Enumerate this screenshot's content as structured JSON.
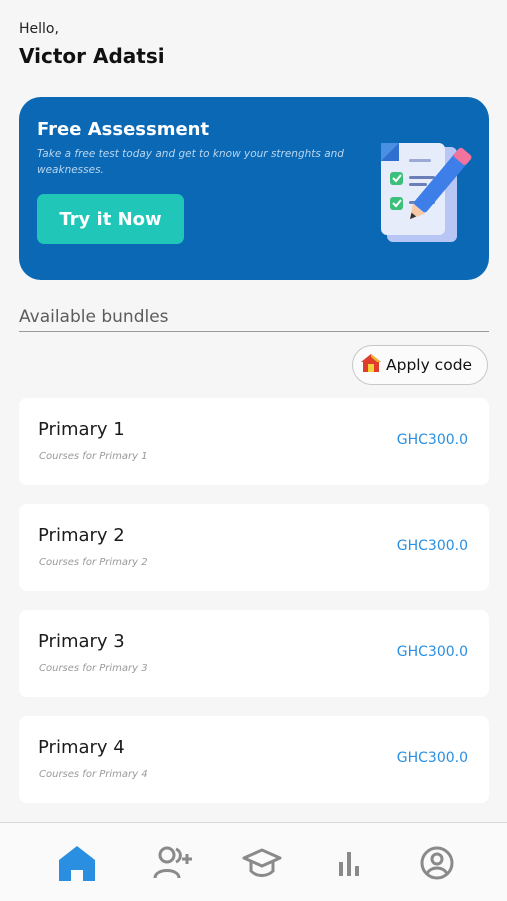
{
  "header": {
    "greeting": "Hello,",
    "user_name": "Victor Adatsi"
  },
  "promo": {
    "title": "Free Assessment",
    "subtitle": "Take a free test today and get to know your strenghts and weaknesses.",
    "button_label": "Try it Now",
    "illustration": "checklist-pencil-icon",
    "bg_color": "#0b68b5",
    "button_color": "#20c7b8"
  },
  "bundles_section": {
    "title": "Available bundles",
    "apply_code_label": "Apply code",
    "apply_code_icon": "house-tag-icon"
  },
  "bundles": [
    {
      "name": "Primary 1",
      "description": "Courses for Primary 1",
      "price": "GHC300.0"
    },
    {
      "name": "Primary 2",
      "description": "Courses for Primary 2",
      "price": "GHC300.0"
    },
    {
      "name": "Primary 3",
      "description": "Courses for Primary 3",
      "price": "GHC300.0"
    },
    {
      "name": "Primary 4",
      "description": "Courses for Primary 4",
      "price": "GHC300.0"
    }
  ],
  "bottom_nav": {
    "items": [
      "home-icon",
      "add-user-icon",
      "graduation-cap-icon",
      "bar-chart-icon",
      "profile-icon"
    ],
    "active": "home-icon",
    "active_color": "#2a8fe0",
    "inactive_color": "#8a8a8a"
  }
}
